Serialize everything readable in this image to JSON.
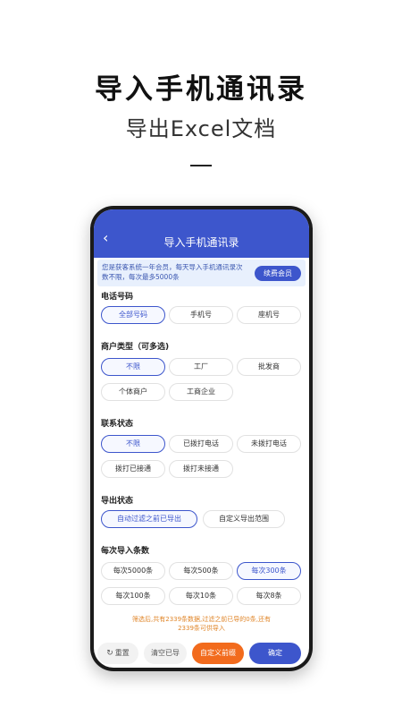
{
  "promo": {
    "title": "导入手机通讯录",
    "subtitle": "导出Excel文档"
  },
  "appbar": {
    "back_icon": "‹",
    "title": "导入手机通讯录"
  },
  "notice": {
    "text": "您是获客系统一年会员，每天导入手机通讯录次数不限，每次最多5000条",
    "renew_label": "续费会员"
  },
  "sections": {
    "phone_type": {
      "label": "电话号码",
      "options": [
        "全部号码",
        "手机号",
        "座机号"
      ],
      "selected": "全部号码"
    },
    "merchant_type": {
      "label": "商户类型（可多选)",
      "options": [
        "不限",
        "工厂",
        "批发商",
        "个体商户",
        "工商企业"
      ],
      "selected": "不限"
    },
    "contact_status": {
      "label": "联系状态",
      "options": [
        "不限",
        "已拨打电话",
        "未拨打电话",
        "拨打已接通",
        "拨打未接通"
      ],
      "selected": "不限"
    },
    "export_status": {
      "label": "导出状态",
      "options": [
        "自动过滤之前已导出",
        "自定义导出范围"
      ],
      "selected": "自动过滤之前已导出"
    },
    "import_count": {
      "label": "每次导入条数",
      "options": [
        "每次5000条",
        "每次500条",
        "每次300条",
        "每次100条",
        "每次10条",
        "每次8条"
      ],
      "selected": "每次300条"
    }
  },
  "summary": {
    "line1": "筛选后,共有2339条数据,过滤之前已导的0条,还有",
    "line2": "2339条可供导入"
  },
  "actions": {
    "reset_icon": "↻",
    "reset_label": "重置",
    "clear_label": "清空已导",
    "custom_label": "自定义前缀",
    "confirm_label": "确定"
  },
  "colors": {
    "primary": "#3d56cc",
    "accent_orange": "#f26b1d",
    "notice_bg": "#e8f0fd",
    "summary_text": "#e0862a"
  }
}
